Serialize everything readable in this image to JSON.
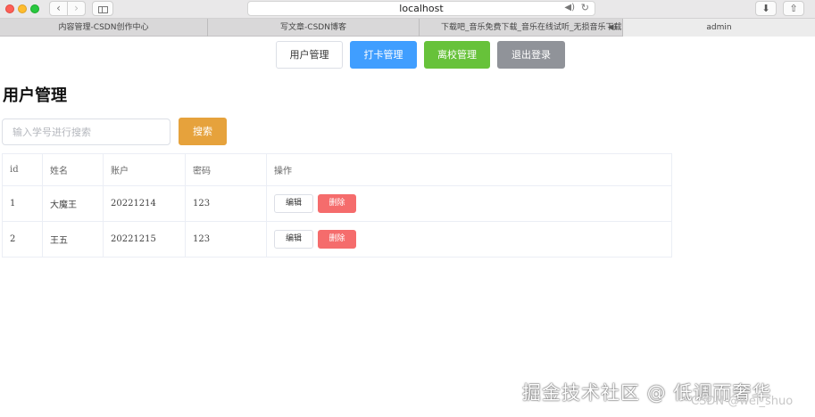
{
  "browser": {
    "address": "localhost",
    "tabs": [
      {
        "label": "内容管理-CSDN创作中心"
      },
      {
        "label": "写文章-CSDN博客"
      },
      {
        "label": "下载吧_音乐免费下载_音乐在线试听_无损音乐下载"
      },
      {
        "label": "admin"
      }
    ]
  },
  "topnav": {
    "users_label": "用户管理",
    "checkin_label": "打卡管理",
    "leave_label": "离校管理",
    "logout_label": "退出登录"
  },
  "page": {
    "title": "用户管理"
  },
  "search": {
    "placeholder": "输入学号进行搜索",
    "value": "",
    "button_label": "搜索"
  },
  "table": {
    "headers": {
      "id": "id",
      "name": "姓名",
      "account": "账户",
      "password": "密码",
      "actions": "操作"
    },
    "rows": [
      {
        "id": "1",
        "name": "大魔王",
        "account": "20221214",
        "password": "123",
        "edit_label": "编辑",
        "delete_label": "删除"
      },
      {
        "id": "2",
        "name": "王五",
        "account": "20221215",
        "password": "123",
        "edit_label": "编辑",
        "delete_label": "删除"
      }
    ]
  },
  "watermark": {
    "main": "掘金技术社区 @ 低调而奢华",
    "sub": "CSDN @wei_shuo"
  },
  "colors": {
    "primary": "#409eff",
    "success": "#67c23a",
    "info": "#909399",
    "warning": "#e6a23c",
    "danger": "#f56c6c"
  }
}
